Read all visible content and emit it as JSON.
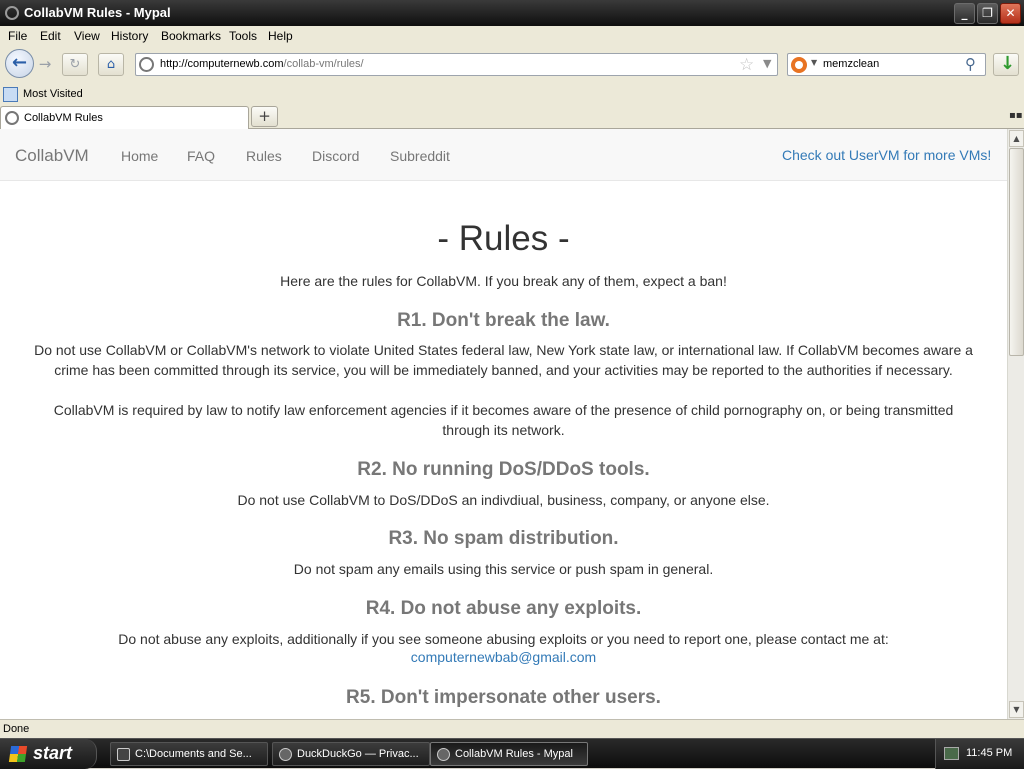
{
  "window": {
    "title": "CollabVM Rules - Mypal"
  },
  "menu": [
    "File",
    "Edit",
    "View",
    "History",
    "Bookmarks",
    "Tools",
    "Help"
  ],
  "address": {
    "host": "http://computernewb.com",
    "path": "/collab-vm/rules/"
  },
  "search": {
    "value": "memzclean"
  },
  "bookmarks": {
    "most_visited": "Most Visited"
  },
  "tabs": [
    {
      "label": "CollabVM Rules"
    }
  ],
  "site": {
    "brand": "CollabVM",
    "nav": [
      "Home",
      "FAQ",
      "Rules",
      "Discord",
      "Subreddit"
    ],
    "external_link": "Check out UserVM for more VMs!"
  },
  "page": {
    "heading": "- Rules -",
    "intro": "Here are the rules for CollabVM. If you break any of them, expect a ban!",
    "rules": [
      {
        "title": "R1. Don't break the law.",
        "paragraphs": [
          "Do not use CollabVM or CollabVM's network to violate United States federal law, New York state law, or international law. If CollabVM becomes aware a crime has been committed through its service, you will be immediately banned, and your activities may be reported to the authorities if necessary.",
          "CollabVM is required by law to notify law enforcement agencies if it becomes aware of the presence of child pornography on, or being transmitted through its network."
        ]
      },
      {
        "title": "R2. No running DoS/DDoS tools.",
        "paragraphs": [
          "Do not use CollabVM to DoS/DDoS an indivdiual, business, company, or anyone else."
        ]
      },
      {
        "title": "R3. No spam distribution.",
        "paragraphs": [
          "Do not spam any emails using this service or push spam in general."
        ]
      },
      {
        "title": "R4. Do not abuse any exploits.",
        "paragraphs": [
          "Do not abuse any exploits, additionally if you see someone abusing exploits or you need to report one, please contact me at:"
        ]
      },
      {
        "title": "R5. Don't impersonate other users.",
        "paragraphs": []
      }
    ],
    "contact_email": "computernewbab@gmail.com"
  },
  "status": "Done",
  "taskbar": {
    "start": "start",
    "items": [
      "C:\\Documents and Se...",
      "DuckDuckGo — Privac...",
      "CollabVM Rules - Mypal"
    ],
    "clock": "11:45 PM"
  },
  "colors": {
    "link": "#337ab7",
    "heading_gray": "#777777",
    "title_bar": "#1a1a1a"
  },
  "icons": [
    "back-arrow-icon",
    "forward-arrow-icon",
    "reload-icon",
    "home-icon",
    "site-identity-icon",
    "bookmark-star-icon",
    "search-engine-icon",
    "magnifier-icon",
    "download-icon",
    "new-tab-plus-icon",
    "windows-flag-icon"
  ]
}
